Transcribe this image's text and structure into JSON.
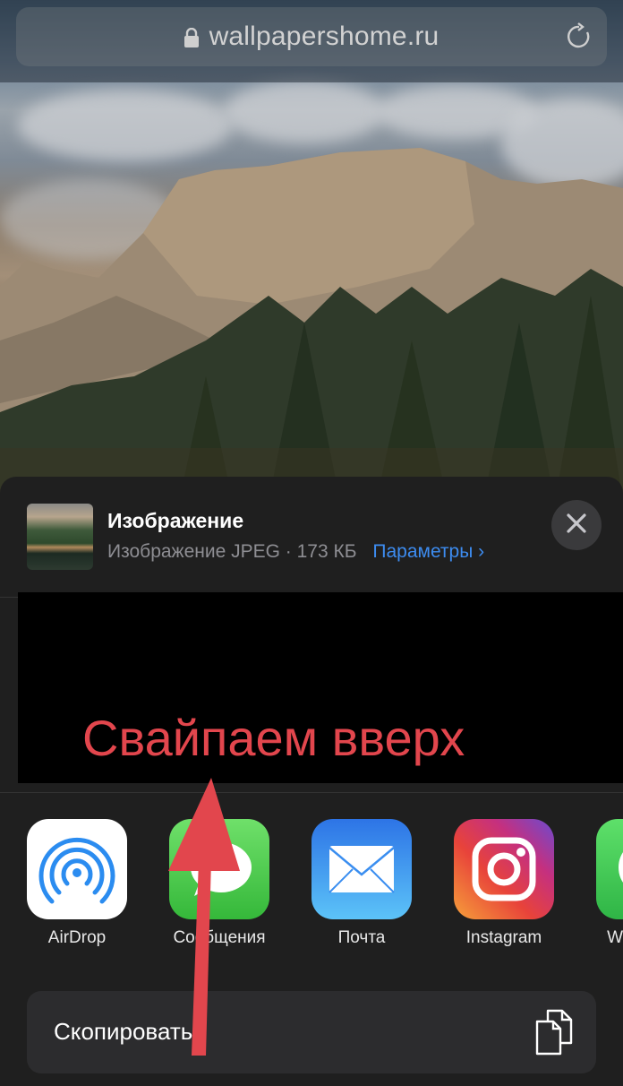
{
  "browser": {
    "url": "wallpapershome.ru",
    "lock_icon": "lock-icon",
    "reload_icon": "reload-icon"
  },
  "share_sheet": {
    "item": {
      "title": "Изображение",
      "type_size": "Изображение JPEG · 173 КБ",
      "options_label": "Параметры",
      "options_chevron": "›"
    },
    "close_icon": "close-icon",
    "apps": [
      {
        "label": "AirDrop",
        "icon": "airdrop-icon"
      },
      {
        "label": "Сообщения",
        "icon": "messages-icon"
      },
      {
        "label": "Почта",
        "icon": "mail-icon"
      },
      {
        "label": "Instagram",
        "icon": "instagram-icon"
      },
      {
        "label": "WhatsApp",
        "icon": "whatsapp-icon"
      }
    ],
    "actions": [
      {
        "label": "Скопировать",
        "icon": "copy-icon"
      }
    ]
  },
  "annotation": {
    "text": "Свайпаем вверх",
    "color": "#e2464d",
    "arrow_direction": "up"
  },
  "colors": {
    "link": "#3d8cf0",
    "sheet_bg": "#1f1f1f",
    "row_bg": "#2c2c2e"
  }
}
